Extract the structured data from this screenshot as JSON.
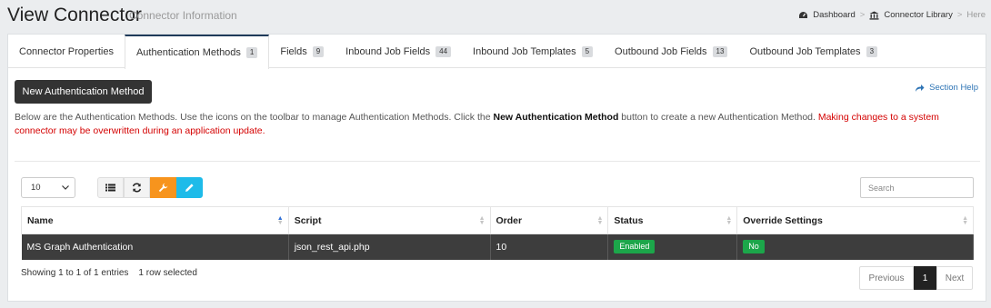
{
  "header": {
    "title": "View Connector",
    "subtitle": "Connector Information",
    "breadcrumb": {
      "dashboard": "Dashboard",
      "sep1": ">",
      "library": "Connector Library",
      "sep2": ">",
      "current": "Here"
    }
  },
  "tabs": [
    {
      "label": "Connector Properties",
      "count": null
    },
    {
      "label": "Authentication Methods",
      "count": "1",
      "active": true
    },
    {
      "label": "Fields",
      "count": "9"
    },
    {
      "label": "Inbound Job Fields",
      "count": "44"
    },
    {
      "label": "Inbound Job Templates",
      "count": "5"
    },
    {
      "label": "Outbound Job Fields",
      "count": "13"
    },
    {
      "label": "Outbound Job Templates",
      "count": "3"
    }
  ],
  "actions": {
    "new_button": "New Authentication Method",
    "help": "Section Help"
  },
  "description": {
    "part1": "Below are the Authentication Methods. Use the icons on the toolbar to manage Authentication Methods. Click the ",
    "bold": "New Authentication Method",
    "part2": " button to create a new Authentication Method. ",
    "warning": "Making changes to a system connector may be overwritten during an application update."
  },
  "controls": {
    "page_length": "10",
    "search_placeholder": "Search"
  },
  "table": {
    "columns": [
      "Name",
      "Script",
      "Order",
      "Status",
      "Override Settings"
    ],
    "rows": [
      {
        "name": "MS Graph Authentication",
        "script": "json_rest_api.php",
        "order": "10",
        "status": "Enabled",
        "override": "No"
      }
    ]
  },
  "footer": {
    "info": "Showing 1 to 1 of 1 entries",
    "selected": "1 row selected",
    "prev": "Previous",
    "page": "1",
    "next": "Next"
  },
  "colors": {
    "primary_dark": "#333333",
    "warning": "#d40000",
    "link": "#2e74b5",
    "orange": "#f7941d",
    "cyan": "#1ebbe9",
    "success": "#1ca64a"
  }
}
